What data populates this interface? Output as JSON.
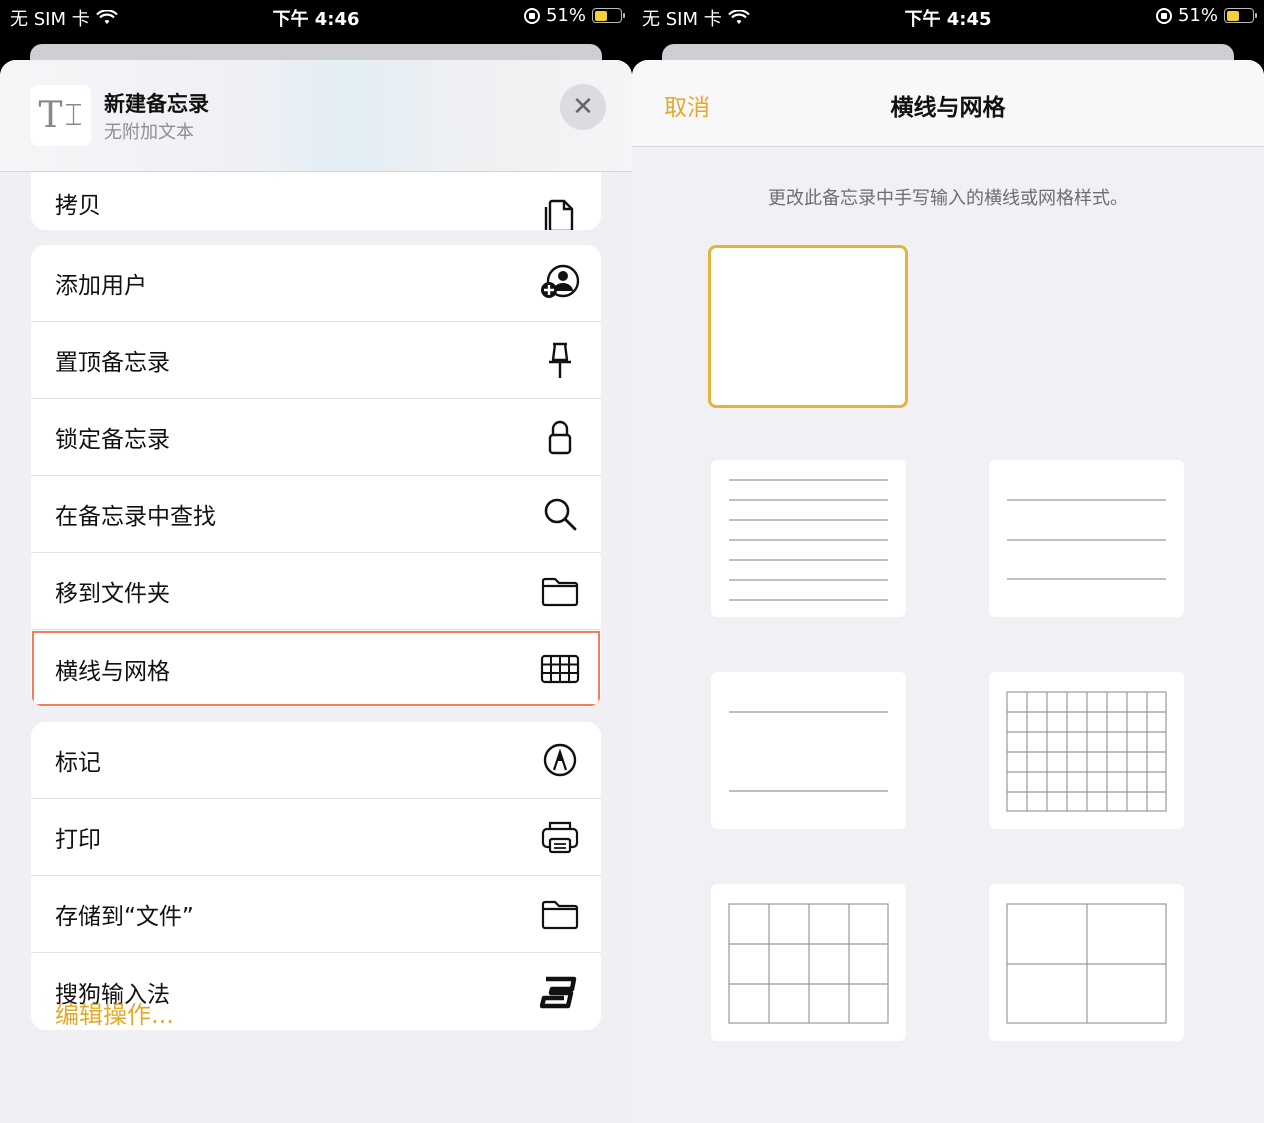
{
  "left": {
    "status": {
      "carrier": "无 SIM 卡",
      "time": "下午 4:46",
      "battery": "51%"
    },
    "header": {
      "title": "新建备忘录",
      "subtitle": "无附加文本",
      "thumb_glyph": "T"
    },
    "group1": [
      {
        "label": "拷贝",
        "icon": "copy-icon"
      }
    ],
    "group2": [
      {
        "label": "添加用户",
        "icon": "add-person-icon"
      },
      {
        "label": "置顶备忘录",
        "icon": "pin-icon"
      },
      {
        "label": "锁定备忘录",
        "icon": "lock-icon"
      },
      {
        "label": "在备忘录中查找",
        "icon": "search-icon"
      },
      {
        "label": "移到文件夹",
        "icon": "folder-icon"
      },
      {
        "label": "横线与网格",
        "icon": "grid-icon"
      }
    ],
    "group3": [
      {
        "label": "标记",
        "icon": "markup-icon"
      },
      {
        "label": "打印",
        "icon": "printer-icon"
      },
      {
        "label": "存储到“文件”",
        "icon": "folder-icon"
      },
      {
        "label": "搜狗输入法",
        "icon": "sogou-icon"
      }
    ],
    "edit_actions": "编辑操作..."
  },
  "right": {
    "status": {
      "carrier": "无 SIM 卡",
      "time": "下午 4:45",
      "battery": "51%"
    },
    "nav": {
      "cancel": "取消",
      "title": "横线与网格"
    },
    "description": "更改此备忘录中手写输入的横线或网格样式。",
    "options": [
      {
        "style": "none",
        "selected": true
      },
      {
        "style": "lines-narrow",
        "selected": false
      },
      {
        "style": "lines-medium",
        "selected": false
      },
      {
        "style": "lines-wide",
        "selected": false
      },
      {
        "style": "grid-small",
        "selected": false
      },
      {
        "style": "grid-medium",
        "selected": false
      },
      {
        "style": "grid-large",
        "selected": false
      }
    ]
  },
  "colors": {
    "accent": "#e3a92a",
    "highlight": "#f07d5b",
    "selected_border": "#e3b43e"
  }
}
